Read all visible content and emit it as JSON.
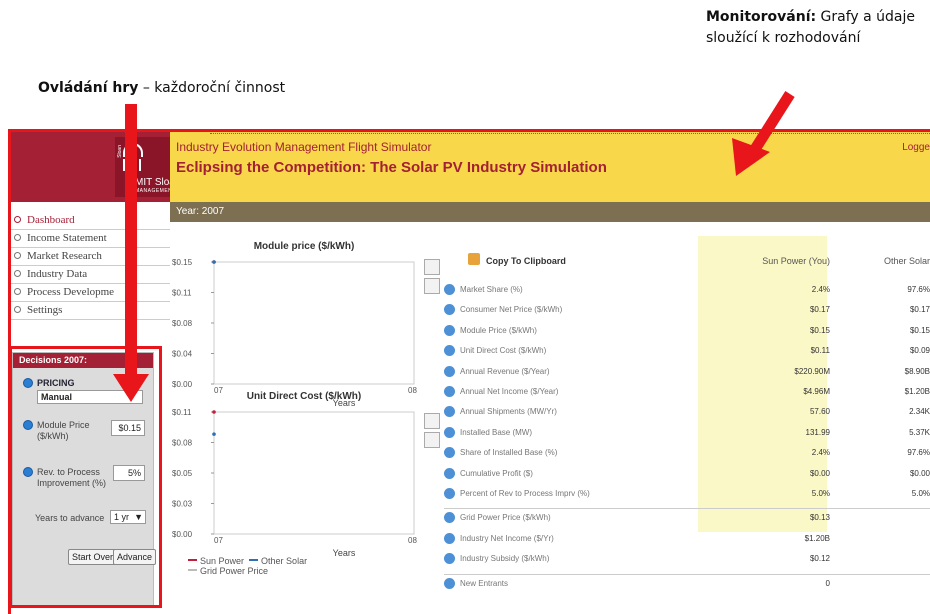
{
  "annotations": {
    "left_bold": "Ovládání hry",
    "left_rest": " – každoroční činnost",
    "right_bold": "Monitorování:",
    "right_rest": " Grafy a údaje sloužící k rozhodování"
  },
  "colors": {
    "brand": "#a32035",
    "banner": "#f8d84a",
    "yearbar": "#7d6f51",
    "highlight": "#fbf8c8",
    "sunpower": "#c0203c",
    "othersolar": "#2f6fb5",
    "annotation_red": "#e8151b"
  },
  "logo": {
    "text": "MIT Sloan",
    "sub": "MANAGEMENT",
    "vert": "Sloan"
  },
  "header": {
    "subtitle": "Industry Evolution Management Flight Simulator",
    "title": "Eclipsing the Competition: The Solar PV Industry Simulation",
    "login": "Logge"
  },
  "year_label": "Year: 2007",
  "nav": {
    "items": [
      {
        "label": "Dashboard",
        "active": true
      },
      {
        "label": "Income Statement"
      },
      {
        "label": "Market Research"
      },
      {
        "label": "Industry Data"
      },
      {
        "label": "Process Developme"
      },
      {
        "label": "Settings"
      }
    ]
  },
  "decisions": {
    "header": "Decisions 2007:",
    "pricing_label": "PRICING",
    "pricing_value": "Manual",
    "module_price_label": "Module Price",
    "module_price_unit": "($/kWh)",
    "module_price_value": "$0.15",
    "rev_label": "Rev. to Process",
    "rev_label2": "Improvement (%)",
    "rev_value": "5%",
    "years_label": "Years to advance",
    "years_value": "1 yr",
    "start_over": "Start Over",
    "advance": "Advance"
  },
  "chart_data": [
    {
      "type": "line",
      "title": "Module price ($/kWh)",
      "xlabel": "Years",
      "ylabel": "",
      "x_ticks": [
        "07",
        "08"
      ],
      "y_ticks": [
        "$0.15",
        "$0.11",
        "$0.08",
        "$0.04",
        "$0.00"
      ],
      "ylim": [
        0,
        0.15
      ],
      "series": [
        {
          "name": "Sun Power",
          "x": [
            2007
          ],
          "y": [
            0.15
          ]
        },
        {
          "name": "Other Solar",
          "x": [
            2007
          ],
          "y": [
            0.15
          ]
        }
      ]
    },
    {
      "type": "line",
      "title": "Unit Direct Cost ($/kWh)",
      "xlabel": "Years",
      "ylabel": "",
      "x_ticks": [
        "07",
        "08"
      ],
      "y_ticks": [
        "$0.11",
        "$0.08",
        "$0.05",
        "$0.03",
        "$0.00"
      ],
      "ylim": [
        0,
        0.11
      ],
      "series": [
        {
          "name": "Sun Power",
          "x": [
            2007
          ],
          "y": [
            0.11
          ]
        },
        {
          "name": "Other Solar",
          "x": [
            2007
          ],
          "y": [
            0.09
          ]
        }
      ]
    }
  ],
  "legend": {
    "sun": "Sun Power",
    "other": "Other Solar",
    "grid": "Grid Power Price"
  },
  "table": {
    "copy_label": "Copy To Clipboard",
    "col1": "Sun Power (You)",
    "col2": "Other Solar",
    "rows": [
      {
        "label": "Market Share (%)",
        "v1": "2.4%",
        "v2": "97.6%"
      },
      {
        "label": "Consumer Net Price ($/kWh)",
        "v1": "$0.17",
        "v2": "$0.17"
      },
      {
        "label": "Module Price ($/kWh)",
        "v1": "$0.15",
        "v2": "$0.15"
      },
      {
        "label": "Unit Direct Cost ($/kWh)",
        "v1": "$0.11",
        "v2": "$0.09"
      },
      {
        "label": "Annual Revenue ($/Year)",
        "v1": "$220.90M",
        "v2": "$8.90B"
      },
      {
        "label": "Annual Net Income ($/Year)",
        "v1": "$4.96M",
        "v2": "$1.20B"
      },
      {
        "label": "Annual Shipments (MW/Yr)",
        "v1": "57.60",
        "v2": "2.34K"
      },
      {
        "label": "Installed Base (MW)",
        "v1": "131.99",
        "v2": "5.37K"
      },
      {
        "label": "Share of Installed Base (%)",
        "v1": "2.4%",
        "v2": "97.6%"
      },
      {
        "label": "Cumulative Profit ($)",
        "v1": "$0.00",
        "v2": "$0.00"
      },
      {
        "label": "Percent of Rev to Process Imprv (%)",
        "v1": "5.0%",
        "v2": "5.0%"
      }
    ],
    "rows2": [
      {
        "label": "Grid Power Price ($/kWh)",
        "v1": "$0.13"
      },
      {
        "label": "Industry Net Income ($/Yr)",
        "v1": "$1.20B"
      },
      {
        "label": "Industry Subsidy ($/kWh)",
        "v1": "$0.12"
      }
    ],
    "rows3": [
      {
        "label": "New Entrants",
        "v1": "0"
      }
    ]
  }
}
